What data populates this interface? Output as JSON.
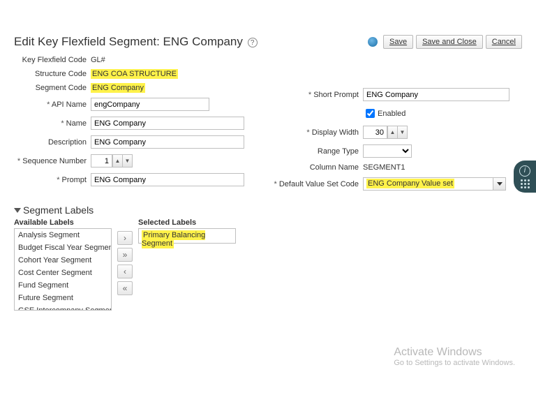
{
  "header": {
    "title_prefix": "Edit Key Flexfield Segment: ",
    "title_value": "ENG Company",
    "buttons": {
      "save": "Save",
      "save_close": "Save and Close",
      "cancel": "Cancel"
    }
  },
  "left": {
    "key_flexfield_code": {
      "label": "Key Flexfield Code",
      "value": "GL#"
    },
    "structure_code": {
      "label": "Structure Code",
      "value": "ENG COA STRUCTURE"
    },
    "segment_code": {
      "label": "Segment Code",
      "value": "ENG Company"
    },
    "api_name": {
      "label": "API Name",
      "value": "engCompany"
    },
    "name": {
      "label": "Name",
      "value": "ENG Company"
    },
    "description": {
      "label": "Description",
      "value": "ENG Company"
    },
    "sequence_number": {
      "label": "Sequence Number",
      "value": "1"
    },
    "prompt": {
      "label": "Prompt",
      "value": "ENG Company"
    }
  },
  "right": {
    "short_prompt": {
      "label": "Short Prompt",
      "value": "ENG Company"
    },
    "enabled": {
      "label": "Enabled",
      "checked": true
    },
    "display_width": {
      "label": "Display Width",
      "value": "30"
    },
    "range_type": {
      "label": "Range Type",
      "value": ""
    },
    "column_name": {
      "label": "Column Name",
      "value": "SEGMENT1"
    },
    "default_value_set_code": {
      "label": "Default Value Set Code",
      "value": "ENG Company Value set"
    }
  },
  "segment_labels": {
    "title": "Segment Labels",
    "available_header": "Available Labels",
    "selected_header": "Selected Labels",
    "available": [
      "Analysis Segment",
      "Budget Fiscal Year Segment",
      "Cohort Year Segment",
      "Cost Center Segment",
      "Fund Segment",
      "Future Segment",
      "GSE Intercompany Segment"
    ],
    "selected": [
      "Primary Balancing Segment"
    ]
  },
  "watermark": {
    "line1": "Activate Windows",
    "line2": "Go to Settings to activate Windows."
  }
}
